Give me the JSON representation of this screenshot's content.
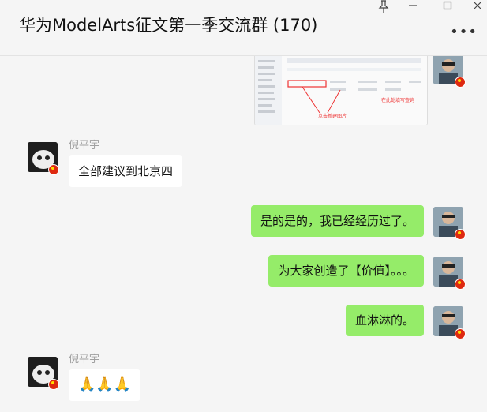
{
  "window": {
    "title": "华为ModelArts征文第一季交流群 (170)",
    "pin_icon": "pin-icon",
    "minimize_icon": "minimize-icon",
    "maximize_icon": "maximize-icon",
    "close_icon": "close-icon",
    "more_icon": "more-icon"
  },
  "image_message": {
    "annotation_left": "点击新建图片",
    "annotation_right": "在此处填写查询"
  },
  "messages": [
    {
      "sender": "倪平宇",
      "text": "全部建议到北京四",
      "direction": "in"
    },
    {
      "text": "是的是的，我已经经历过了。",
      "direction": "out"
    },
    {
      "text": "为大家创造了【价值】。。。",
      "direction": "out"
    },
    {
      "text": "血淋淋的。",
      "direction": "out"
    },
    {
      "sender": "倪平宇",
      "text": "🙏🙏🙏",
      "direction": "in"
    }
  ],
  "colors": {
    "out_bubble": "#95ec69",
    "in_bubble": "#ffffff",
    "flag_red": "#de2910"
  }
}
